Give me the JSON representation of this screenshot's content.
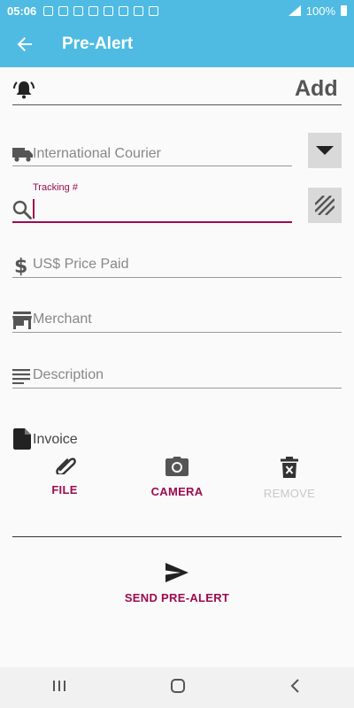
{
  "status_bar": {
    "time": "05:06",
    "battery": "100%"
  },
  "app_bar": {
    "title": "Pre-Alert"
  },
  "add_row": {
    "add_label": "Add"
  },
  "courier": {
    "placeholder": "International Courier"
  },
  "tracking": {
    "label": "Tracking #",
    "value": ""
  },
  "price": {
    "placeholder": "US$ Price Paid"
  },
  "merchant": {
    "placeholder": "Merchant"
  },
  "description": {
    "placeholder": "Description"
  },
  "invoice": {
    "label": "Invoice",
    "file_label": "FILE",
    "camera_label": "CAMERA",
    "remove_label": "REMOVE"
  },
  "send": {
    "label": "SEND PRE-ALERT"
  },
  "colors": {
    "accent": "#9c0b4f",
    "appbar": "#4fbbe3"
  },
  "icons": [
    "back-arrow-icon",
    "alarm-icon",
    "truck-icon",
    "search-icon",
    "dollar-icon",
    "store-icon",
    "notes-icon",
    "file-icon",
    "paperclip-icon",
    "camera-icon",
    "delete-icon",
    "send-icon"
  ]
}
